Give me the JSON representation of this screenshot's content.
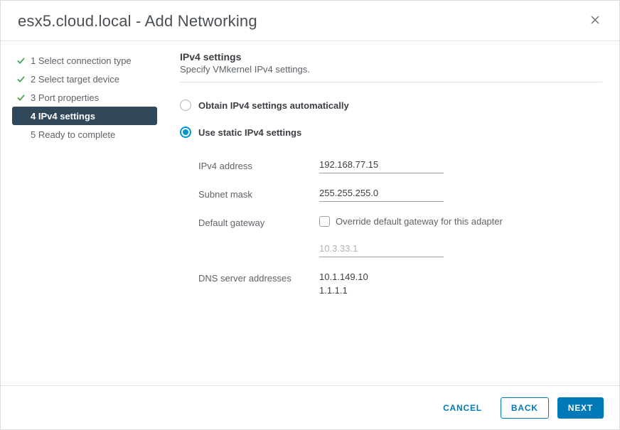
{
  "header": {
    "title": "esx5.cloud.local - Add Networking"
  },
  "sidebar": {
    "steps": [
      {
        "label": "1 Select connection type"
      },
      {
        "label": "2 Select target device"
      },
      {
        "label": "3 Port properties"
      },
      {
        "label": "4 IPv4 settings"
      },
      {
        "label": "5 Ready to complete"
      }
    ]
  },
  "main": {
    "section_title": "IPv4 settings",
    "section_desc": "Specify VMkernel IPv4 settings.",
    "radio_auto": "Obtain IPv4 settings automatically",
    "radio_static": "Use static IPv4 settings",
    "labels": {
      "ipv4": "IPv4 address",
      "subnet": "Subnet mask",
      "gateway": "Default gateway",
      "override": "Override default gateway for this adapter",
      "dns": "DNS server addresses"
    },
    "values": {
      "ipv4": "192.168.77.15",
      "subnet": "255.255.255.0",
      "gateway_default": "10.3.33.1",
      "dns1": "10.1.149.10",
      "dns2": "1.1.1.1"
    }
  },
  "footer": {
    "cancel": "CANCEL",
    "back": "BACK",
    "next": "NEXT"
  }
}
